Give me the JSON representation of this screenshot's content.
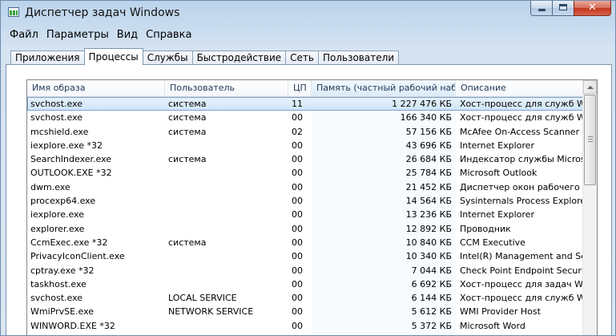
{
  "window": {
    "title": "Диспетчер задач Windows"
  },
  "caption": {
    "minimize": "",
    "maximize": "",
    "close": "✕"
  },
  "menu": [
    "Файл",
    "Параметры",
    "Вид",
    "Справка"
  ],
  "tabs": [
    "Приложения",
    "Процессы",
    "Службы",
    "Быстродействие",
    "Сеть",
    "Пользователи"
  ],
  "active_tab": "Процессы",
  "columns": {
    "name": "Имя образа",
    "user": "Пользователь",
    "cpu": "ЦП",
    "memory": "Память (частный рабочий набор)",
    "description": "Описание"
  },
  "processes": [
    {
      "name": "svchost.exe",
      "user": "система",
      "cpu": "11",
      "memory": "1 227 476 КБ",
      "description": "Хост-процесс для служб Windo"
    },
    {
      "name": "svchost.exe",
      "user": "система",
      "cpu": "00",
      "memory": "166 340 КБ",
      "description": "Хост-процесс для служб Windo"
    },
    {
      "name": "mcshield.exe",
      "user": "система",
      "cpu": "02",
      "memory": "57 156 КБ",
      "description": "McAfee On-Access Scanner serv"
    },
    {
      "name": "iexplore.exe *32",
      "user": "",
      "cpu": "00",
      "memory": "43 696 КБ",
      "description": "Internet Explorer"
    },
    {
      "name": "SearchIndexer.exe",
      "user": "система",
      "cpu": "00",
      "memory": "26 684 КБ",
      "description": "Индексатор службы Microsoft W"
    },
    {
      "name": "OUTLOOK.EXE *32",
      "user": "",
      "cpu": "00",
      "memory": "25 784 КБ",
      "description": "Microsoft Outlook"
    },
    {
      "name": "dwm.exe",
      "user": "",
      "cpu": "00",
      "memory": "21 452 КБ",
      "description": "Диспетчер окон рабочего стола"
    },
    {
      "name": "procexp64.exe",
      "user": "",
      "cpu": "00",
      "memory": "14 564 КБ",
      "description": "Sysinternals Process Explorer"
    },
    {
      "name": "iexplore.exe",
      "user": "",
      "cpu": "00",
      "memory": "13 236 КБ",
      "description": "Internet Explorer"
    },
    {
      "name": "explorer.exe",
      "user": "",
      "cpu": "00",
      "memory": "12 892 КБ",
      "description": "Проводник"
    },
    {
      "name": "CcmExec.exe *32",
      "user": "система",
      "cpu": "00",
      "memory": "10 840 КБ",
      "description": "CCM Executive"
    },
    {
      "name": "PrivacyIconClient.exe",
      "user": "",
      "cpu": "00",
      "memory": "10 340 КБ",
      "description": "Intel(R) Management and Secur"
    },
    {
      "name": "cptray.exe *32",
      "user": "",
      "cpu": "00",
      "memory": "7 044 КБ",
      "description": "Check Point Endpoint Security"
    },
    {
      "name": "taskhost.exe",
      "user": "",
      "cpu": "00",
      "memory": "6 692 КБ",
      "description": "Хост-процесс для задач Window"
    },
    {
      "name": "svchost.exe",
      "user": "LOCAL SERVICE",
      "cpu": "00",
      "memory": "6 144 КБ",
      "description": "Хост-процесс для служб Windo"
    },
    {
      "name": "WmiPrvSE.exe",
      "user": "NETWORK SERVICE",
      "cpu": "00",
      "memory": "5 612 КБ",
      "description": "WMI Provider Host"
    },
    {
      "name": "WINWORD.EXE *32",
      "user": "",
      "cpu": "00",
      "memory": "5 372 КБ",
      "description": "Microsoft Word"
    }
  ]
}
